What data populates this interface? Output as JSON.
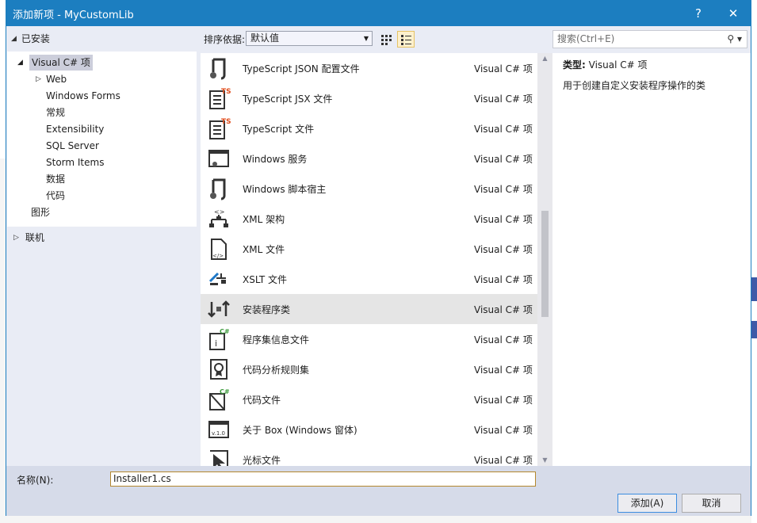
{
  "window": {
    "title": "添加新项 - MyCustomLib",
    "help": "?",
    "close": "✕"
  },
  "tree": {
    "installed": "已安装",
    "visual_csharp": "Visual C# 项",
    "children": [
      "Web",
      "Windows Forms",
      "常规",
      "Extensibility",
      "SQL Server",
      "Storm Items",
      "数据",
      "代码"
    ],
    "graphics": "图形",
    "online": "联机"
  },
  "toolbar": {
    "sort_label": "排序依据:",
    "sort_value": "默认值",
    "search_placeholder": "搜索(Ctrl+E)"
  },
  "items": [
    {
      "name": "TypeScript JSON 配置文件",
      "type": "Visual C# 项",
      "icon": "script-icon"
    },
    {
      "name": "TypeScript JSX 文件",
      "type": "Visual C# 项",
      "icon": "ts-file-icon"
    },
    {
      "name": "TypeScript 文件",
      "type": "Visual C# 项",
      "icon": "ts-file-icon"
    },
    {
      "name": "Windows 服务",
      "type": "Visual C# 项",
      "icon": "windows-service-icon"
    },
    {
      "name": "Windows 脚本宿主",
      "type": "Visual C# 项",
      "icon": "script-icon"
    },
    {
      "name": "XML 架构",
      "type": "Visual C# 项",
      "icon": "xml-schema-icon"
    },
    {
      "name": "XML 文件",
      "type": "Visual C# 项",
      "icon": "xml-file-icon"
    },
    {
      "name": "XSLT 文件",
      "type": "Visual C# 项",
      "icon": "xslt-icon"
    },
    {
      "name": "安装程序类",
      "type": "Visual C# 项",
      "icon": "installer-icon"
    },
    {
      "name": "程序集信息文件",
      "type": "Visual C# 项",
      "icon": "assembly-info-icon"
    },
    {
      "name": "代码分析规则集",
      "type": "Visual C# 项",
      "icon": "ruleset-icon"
    },
    {
      "name": "代码文件",
      "type": "Visual C# 项",
      "icon": "code-file-icon"
    },
    {
      "name": "关于 Box (Windows 窗体)",
      "type": "Visual C# 项",
      "icon": "about-box-icon"
    },
    {
      "name": "光标文件",
      "type": "Visual C# 项",
      "icon": "cursor-file-icon"
    }
  ],
  "selected_index": 8,
  "detail": {
    "type_label": "类型:",
    "type_value": "Visual C# 项",
    "description": "用于创建自定义安装程序操作的类"
  },
  "footer": {
    "name_label": "名称(N):",
    "name_value": "Installer1.cs",
    "add": "添加(A)",
    "cancel": "取消"
  }
}
